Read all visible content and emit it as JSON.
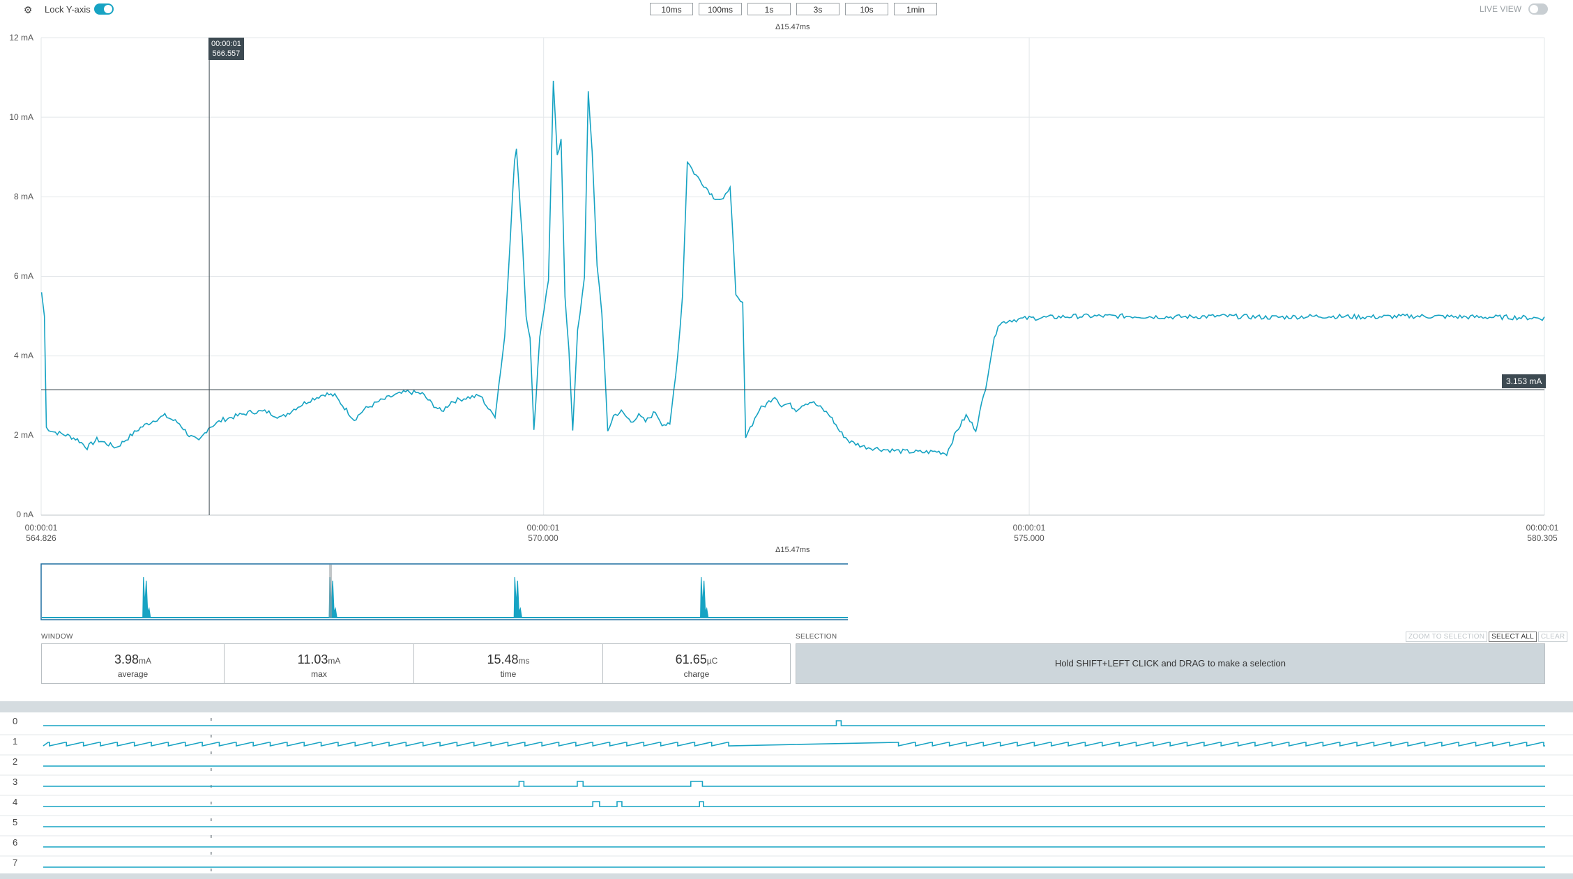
{
  "toolbar": {
    "lock_y_label": "Lock Y-axis",
    "lock_y_on": true,
    "window_buttons": [
      "10ms",
      "100ms",
      "1s",
      "3s",
      "10s",
      "1min"
    ],
    "live_view_label": "LIVE VIEW",
    "live_view_on": false
  },
  "chart": {
    "delta_top": "Δ15.47ms",
    "delta_bottom": "Δ15.47ms",
    "cursor_label_line1": "00:00:01",
    "cursor_label_line2": "566.557",
    "value_label": "3.153 mA",
    "y_ticks": [
      "12 mA",
      "10 mA",
      "8 mA",
      "6 mA",
      "4 mA",
      "2 mA",
      "0 nA"
    ],
    "x_ticks": [
      {
        "line1": "00:00:01",
        "line2": "564.826"
      },
      {
        "line1": "00:00:01",
        "line2": "570.000"
      },
      {
        "line1": "00:00:01",
        "line2": "575.000"
      },
      {
        "line1": "00:00:01",
        "line2": "580.305"
      }
    ]
  },
  "chart_data": {
    "type": "line",
    "title": "",
    "xlabel": "",
    "ylabel": "",
    "x_unit": "ms",
    "y_unit": "mA",
    "xlim": [
      564.826,
      580.305
    ],
    "ylim": [
      0,
      12
    ],
    "cursor_x": 566.557,
    "horizontal_marker_y": 3.153,
    "series": [
      {
        "color": "#17a3c3",
        "points": [
          [
            564.83,
            5.6
          ],
          [
            564.86,
            5.0
          ],
          [
            564.88,
            2.2
          ],
          [
            564.95,
            2.1
          ],
          [
            565.1,
            2.0
          ],
          [
            565.2,
            1.9
          ],
          [
            565.3,
            1.7
          ],
          [
            565.4,
            1.9
          ],
          [
            565.5,
            1.8
          ],
          [
            565.6,
            1.7
          ],
          [
            565.7,
            1.9
          ],
          [
            565.85,
            2.2
          ],
          [
            566.0,
            2.4
          ],
          [
            566.1,
            2.5
          ],
          [
            566.25,
            2.3
          ],
          [
            566.35,
            2.0
          ],
          [
            566.45,
            1.85
          ],
          [
            566.55,
            2.2
          ],
          [
            566.7,
            2.4
          ],
          [
            566.85,
            2.5
          ],
          [
            567.0,
            2.6
          ],
          [
            567.15,
            2.6
          ],
          [
            567.3,
            2.45
          ],
          [
            567.45,
            2.7
          ],
          [
            567.6,
            2.9
          ],
          [
            567.75,
            3.05
          ],
          [
            567.85,
            3.0
          ],
          [
            567.95,
            2.7
          ],
          [
            568.05,
            2.4
          ],
          [
            568.15,
            2.65
          ],
          [
            568.3,
            2.85
          ],
          [
            568.45,
            3.0
          ],
          [
            568.6,
            3.1
          ],
          [
            568.75,
            3.05
          ],
          [
            568.85,
            2.8
          ],
          [
            568.95,
            2.6
          ],
          [
            569.05,
            2.85
          ],
          [
            569.2,
            2.95
          ],
          [
            569.35,
            3.0
          ],
          [
            569.45,
            2.6
          ],
          [
            569.5,
            2.5
          ],
          [
            569.6,
            4.5
          ],
          [
            569.7,
            8.9
          ],
          [
            569.72,
            9.2
          ],
          [
            569.78,
            7.0
          ],
          [
            569.82,
            5.0
          ],
          [
            569.86,
            4.5
          ],
          [
            569.9,
            2.1
          ],
          [
            569.96,
            4.5
          ],
          [
            570.05,
            5.9
          ],
          [
            570.1,
            10.9
          ],
          [
            570.14,
            9.0
          ],
          [
            570.18,
            9.4
          ],
          [
            570.22,
            5.5
          ],
          [
            570.26,
            4.2
          ],
          [
            570.3,
            2.1
          ],
          [
            570.35,
            4.6
          ],
          [
            570.42,
            6.0
          ],
          [
            570.46,
            10.6
          ],
          [
            570.5,
            9.1
          ],
          [
            570.55,
            6.3
          ],
          [
            570.6,
            5.1
          ],
          [
            570.66,
            2.1
          ],
          [
            570.72,
            2.5
          ],
          [
            570.8,
            2.6
          ],
          [
            570.9,
            2.35
          ],
          [
            570.98,
            2.5
          ],
          [
            571.05,
            2.35
          ],
          [
            571.15,
            2.6
          ],
          [
            571.22,
            2.3
          ],
          [
            571.3,
            2.25
          ],
          [
            571.38,
            4.0
          ],
          [
            571.43,
            5.5
          ],
          [
            571.48,
            8.9
          ],
          [
            571.55,
            8.6
          ],
          [
            571.65,
            8.3
          ],
          [
            571.75,
            8.0
          ],
          [
            571.85,
            7.9
          ],
          [
            571.92,
            8.3
          ],
          [
            571.98,
            5.5
          ],
          [
            572.05,
            5.3
          ],
          [
            572.08,
            2.0
          ],
          [
            572.15,
            2.3
          ],
          [
            572.22,
            2.65
          ],
          [
            572.3,
            2.8
          ],
          [
            572.38,
            3.0
          ],
          [
            572.45,
            2.75
          ],
          [
            572.52,
            2.8
          ],
          [
            572.6,
            2.65
          ],
          [
            572.68,
            2.8
          ],
          [
            572.76,
            2.85
          ],
          [
            572.85,
            2.7
          ],
          [
            572.95,
            2.5
          ],
          [
            573.05,
            2.1
          ],
          [
            573.15,
            1.85
          ],
          [
            573.3,
            1.72
          ],
          [
            573.5,
            1.65
          ],
          [
            573.7,
            1.6
          ],
          [
            573.9,
            1.58
          ],
          [
            574.05,
            1.6
          ],
          [
            574.15,
            1.55
          ],
          [
            574.25,
            2.1
          ],
          [
            574.35,
            2.5
          ],
          [
            574.45,
            2.15
          ],
          [
            574.55,
            3.2
          ],
          [
            574.62,
            4.2
          ],
          [
            574.68,
            4.8
          ],
          [
            574.8,
            4.9
          ],
          [
            575.0,
            4.95
          ],
          [
            575.5,
            5.0
          ],
          [
            576.0,
            5.0
          ],
          [
            576.5,
            4.98
          ],
          [
            577.0,
            5.0
          ],
          [
            577.5,
            4.97
          ],
          [
            578.0,
            5.0
          ],
          [
            578.5,
            4.98
          ],
          [
            579.0,
            5.0
          ],
          [
            579.5,
            4.98
          ],
          [
            580.0,
            4.97
          ],
          [
            580.305,
            4.95
          ]
        ]
      }
    ],
    "overview_pulse_positions_pct": [
      6.9,
      19.3,
      31.6,
      44.0,
      56.4,
      68.8,
      81.2,
      93.6
    ]
  },
  "window_stats": {
    "section_label": "WINDOW",
    "items": [
      {
        "value": "3.98",
        "unit": "mA",
        "label": "average"
      },
      {
        "value": "11.03",
        "unit": "mA",
        "label": "max"
      },
      {
        "value": "15.48",
        "unit": "ms",
        "label": "time"
      },
      {
        "value": "61.65",
        "unit": "µC",
        "label": "charge"
      }
    ]
  },
  "selection": {
    "section_label": "SELECTION",
    "buttons": [
      "ZOOM TO SELECTION",
      "SELECT ALL",
      "CLEAR"
    ],
    "hint": "Hold SHIFT+LEFT CLICK and DRAG to make a selection"
  },
  "digital_channels": {
    "labels": [
      "0",
      "1",
      "2",
      "3",
      "4",
      "5",
      "6",
      "7"
    ],
    "pulses": {
      "0": [
        [
          573.0,
          573.05
        ]
      ],
      "3": [
        [
          569.73,
          569.78
        ],
        [
          570.33,
          570.39
        ],
        [
          571.5,
          571.62
        ]
      ],
      "4": [
        [
          570.49,
          570.56
        ],
        [
          570.74,
          570.79
        ],
        [
          571.59,
          571.63
        ]
      ]
    }
  }
}
